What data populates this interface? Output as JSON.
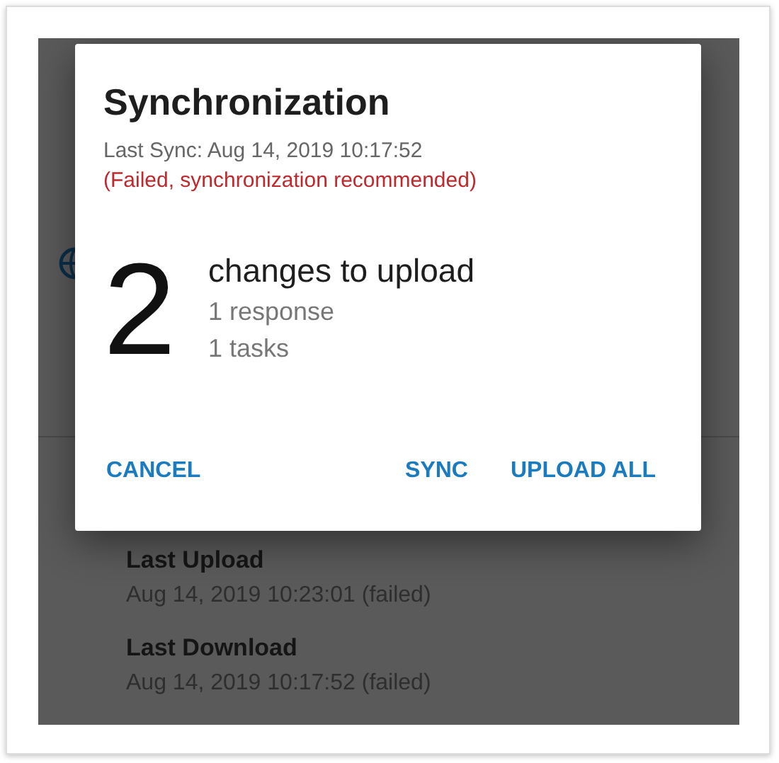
{
  "background": {
    "items": [
      {
        "title": "Last Upload",
        "detail": "Aug 14, 2019 10:23:01 (failed)"
      },
      {
        "title": "Last Download",
        "detail": "Aug 14, 2019 10:17:52 (failed)"
      }
    ]
  },
  "dialog": {
    "title": "Synchronization",
    "last_sync": "Last Sync: Aug 14, 2019 10:17:52",
    "warning": "(Failed, synchronization recommended)",
    "count": "2",
    "summary": "changes to upload",
    "details": [
      "1 response",
      "1 tasks"
    ],
    "buttons": [
      {
        "label": "CANCEL"
      },
      {
        "label": "SYNC"
      },
      {
        "label": "UPLOAD ALL"
      }
    ]
  }
}
